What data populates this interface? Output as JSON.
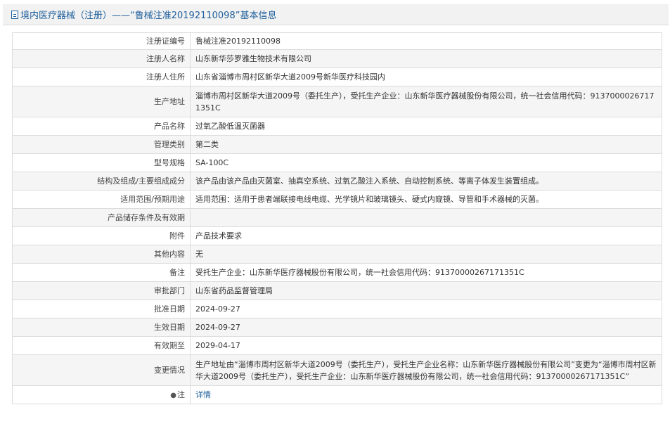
{
  "header": {
    "title": "境内医疗器械（注册）——“鲁械注准20192110098”基本信息"
  },
  "rows": [
    {
      "label": "注册证编号",
      "value": "鲁械注准20192110098"
    },
    {
      "label": "注册人名称",
      "value": "山东新华莎罗雅生物技术有限公司"
    },
    {
      "label": "注册人住所",
      "value": "山东省淄博市周村区新华大道2009号新华医疗科技园内"
    },
    {
      "label": "生产地址",
      "value": "淄博市周村区新华大道2009号（委托生产），受托生产企业：山东新华医疗器械股份有限公司，统一社会信用代码：91370000267171351C"
    },
    {
      "label": "产品名称",
      "value": "过氧乙酸低温灭菌器"
    },
    {
      "label": "管理类别",
      "value": "第二类"
    },
    {
      "label": "型号规格",
      "value": "SA-100C"
    },
    {
      "label": "结构及组成/主要组成成分",
      "value": "该产品由该产品由灭菌室、抽真空系统、过氧乙酸注入系统、自动控制系统、等离子体发生装置组成。"
    },
    {
      "label": "适用范围/预期用途",
      "value": "适用范围：适用于患者端联接电线电缆、光学镜片和玻璃镜头、硬式内窥镜、导管和手术器械的灭菌。"
    },
    {
      "label": "产品储存条件及有效期",
      "value": ""
    },
    {
      "label": "附件",
      "value": "产品技术要求"
    },
    {
      "label": "其他内容",
      "value": "无"
    },
    {
      "label": "备注",
      "value": "受托生产企业：山东新华医疗器械股份有限公司，统一社会信用代码：91370000267171351C"
    },
    {
      "label": "审批部门",
      "value": "山东省药品监督管理局"
    },
    {
      "label": "批准日期",
      "value": "2024-09-27"
    },
    {
      "label": "生效日期",
      "value": "2024-09-27"
    },
    {
      "label": "有效期至",
      "value": "2029-04-17"
    },
    {
      "label": "变更情况",
      "value": "生产地址由“淄博市周村区新华大道2009号（委托生产），受托生产企业名称：山东新华医疗器械股份有限公司”变更为“淄博市周村区新华大道2009号（委托生产），受托生产企业：山东新华医疗器械股份有限公司，统一社会信用代码：91370000267171351C”"
    }
  ],
  "note": {
    "label": "注",
    "link_text": "详情",
    "icon": "pin-icon"
  },
  "colors": {
    "link": "#1f5f9c",
    "header_bg": "#f2f2f2",
    "border": "#dcdcdc",
    "row_alt": "#f5f5f5"
  }
}
